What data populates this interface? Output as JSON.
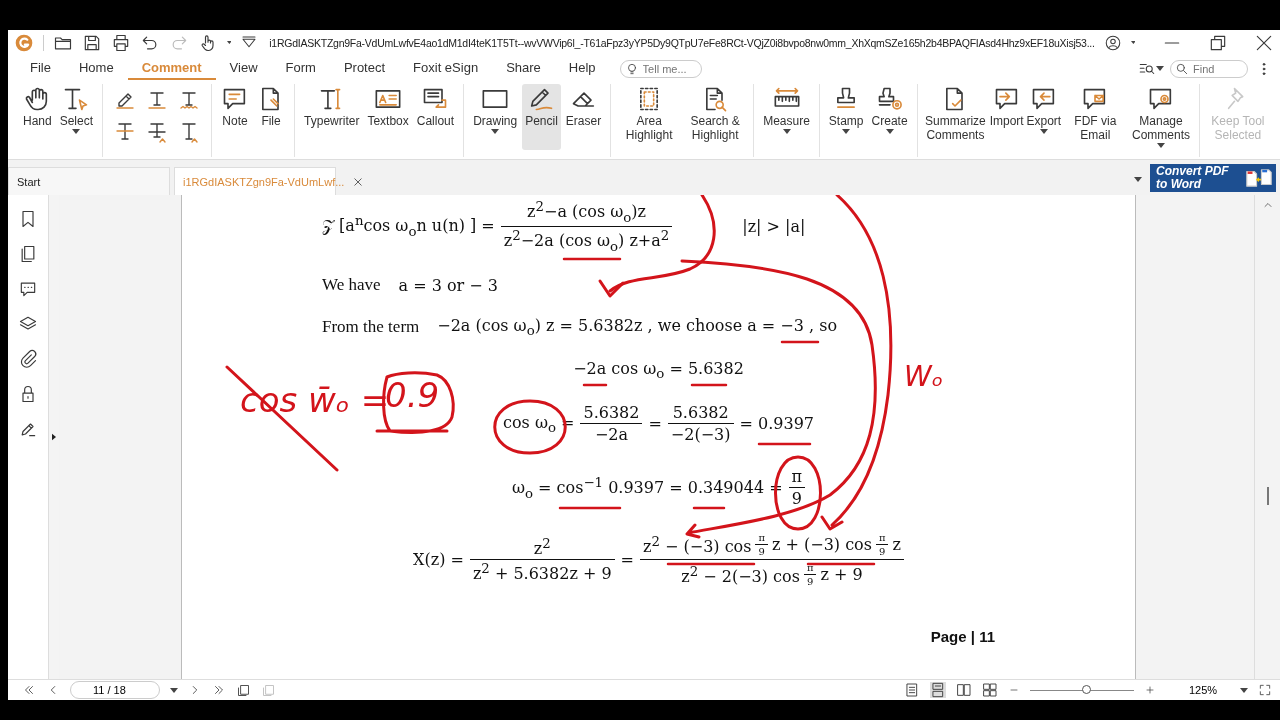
{
  "title_bar": {
    "file_name": "i1RGdIASKTZgn9Fa-VdUmLwfvE4ao1dM1dI4teK1T5Tt--wvVWVip6l_-T61aFpz3yYP5Dy9QTpU7eFe8RCt-VQjZ0i8bvpo8nw0mm_XhXqmSZe165h2b4BPAQFIAsd4Hhz9xEF18uXisj53..."
  },
  "menu": {
    "tabs": [
      {
        "label": "File",
        "selected": false
      },
      {
        "label": "Home",
        "selected": false
      },
      {
        "label": "Comment",
        "selected": true
      },
      {
        "label": "View",
        "selected": false
      },
      {
        "label": "Form",
        "selected": false
      },
      {
        "label": "Protect",
        "selected": false
      },
      {
        "label": "Foxit eSign",
        "selected": false
      },
      {
        "label": "Share",
        "selected": false
      },
      {
        "label": "Help",
        "selected": false
      }
    ],
    "tell_me": {
      "placeholder": "Tell me..."
    },
    "find": {
      "placeholder": "Find"
    }
  },
  "ribbon": {
    "groups": [
      {
        "kind": "tools",
        "tools": [
          {
            "label": "Hand",
            "caret": false,
            "selected": false,
            "disabled": false
          },
          {
            "label": "Select",
            "caret": true,
            "selected": false,
            "disabled": false
          }
        ]
      },
      {
        "kind": "markup"
      },
      {
        "kind": "tools",
        "tools": [
          {
            "label": "Note",
            "caret": false,
            "selected": false,
            "disabled": false
          },
          {
            "label": "File",
            "caret": false,
            "selected": false,
            "disabled": false
          }
        ]
      },
      {
        "kind": "tools",
        "tools": [
          {
            "label": "Typewriter",
            "caret": false,
            "selected": false,
            "disabled": false
          },
          {
            "label": "Textbox",
            "caret": false,
            "selected": false,
            "disabled": false
          },
          {
            "label": "Callout",
            "caret": false,
            "selected": false,
            "disabled": false
          }
        ]
      },
      {
        "kind": "tools",
        "tools": [
          {
            "label": "Drawing",
            "caret": true,
            "selected": false,
            "disabled": false
          },
          {
            "label": "Pencil",
            "caret": false,
            "selected": true,
            "disabled": false
          },
          {
            "label": "Eraser",
            "caret": false,
            "selected": false,
            "disabled": false
          }
        ]
      },
      {
        "kind": "tools",
        "tools": [
          {
            "label": "Area Highlight",
            "caret": false,
            "selected": false,
            "disabled": false
          },
          {
            "label": "Search & Highlight",
            "caret": false,
            "selected": false,
            "disabled": false
          }
        ]
      },
      {
        "kind": "tools",
        "tools": [
          {
            "label": "Measure",
            "caret": true,
            "selected": false,
            "disabled": false
          }
        ]
      },
      {
        "kind": "tools",
        "tools": [
          {
            "label": "Stamp",
            "caret": true,
            "selected": false,
            "disabled": false
          },
          {
            "label": "Create",
            "caret": true,
            "selected": false,
            "disabled": false
          }
        ]
      },
      {
        "kind": "tools",
        "tools": [
          {
            "label": "Summarize Comments",
            "caret": false,
            "selected": false,
            "disabled": false
          },
          {
            "label": "Import",
            "caret": false,
            "selected": false,
            "disabled": false
          },
          {
            "label": "Export",
            "caret": true,
            "selected": false,
            "disabled": false
          },
          {
            "label": "FDF via Email",
            "caret": false,
            "selected": false,
            "disabled": false
          },
          {
            "label": "Manage Comments",
            "caret": true,
            "selected": false,
            "disabled": false
          }
        ]
      },
      {
        "kind": "tools",
        "tools": [
          {
            "label": "Keep Tool Selected",
            "caret": false,
            "selected": false,
            "disabled": true
          }
        ]
      }
    ]
  },
  "doc_tabs": [
    {
      "label": "Start",
      "selected": false,
      "closable": false
    },
    {
      "label": "i1RGdIASKTZgn9Fa-VdUmLwf...",
      "selected": true,
      "closable": true
    }
  ],
  "banner": {
    "text": "Convert PDF to Word"
  },
  "page": {
    "lines": [
      {
        "kind": "statement",
        "parts": [
          {
            "kind": "text",
            "text": "𝒵 [a$^{n}$cos ω$_{o}$n u(n) ] ="
          },
          {
            "kind": "fraction",
            "num": "z$^{2}$−a (cos ω$_{o}$)z",
            "den": "z$^{2}$−2a (cos ω$_{o}$) z+a$^{2}$"
          },
          {
            "kind": "aside",
            "text": "|z| > |a|"
          }
        ]
      },
      {
        "kind": "statement",
        "parts": [
          {
            "kind": "prose",
            "text": "We have"
          },
          {
            "kind": "text",
            "text": "a = 3 or − 3"
          }
        ]
      },
      {
        "kind": "statement",
        "parts": [
          {
            "kind": "prose",
            "text": "From the term"
          },
          {
            "kind": "text",
            "text": "−2a (cos ω$_{o}$) z = 5.6382z , we choose a = −3 , so"
          }
        ]
      },
      {
        "kind": "display",
        "parts": [
          {
            "kind": "text",
            "text": "−2a cos ω$_{o}$ = 5.6382"
          }
        ]
      },
      {
        "kind": "display",
        "parts": [
          {
            "kind": "text",
            "text": "cos ω$_{o}$ ="
          },
          {
            "kind": "fraction",
            "num": "5.6382",
            "den": "−2a"
          },
          {
            "kind": "text",
            "text": "="
          },
          {
            "kind": "fraction",
            "num": "5.6382",
            "den": "−2(−3)"
          },
          {
            "kind": "text",
            "text": "= 0.9397"
          }
        ]
      },
      {
        "kind": "display",
        "parts": [
          {
            "kind": "text",
            "text": "ω$_{o}$ = cos$^{−1}$ 0.9397 = 0.349044 ="
          },
          {
            "kind": "fraction",
            "num": "π",
            "den": "9"
          }
        ]
      },
      {
        "kind": "display",
        "parts": [
          {
            "kind": "text",
            "text": "X(z) ="
          },
          {
            "kind": "fraction",
            "num": "z$^{2}$",
            "den": "z$^{2}$ + 5.6382z + 9"
          },
          {
            "kind": "text",
            "text": "="
          },
          {
            "kind": "fraction",
            "num": [
              {
                "kind": "text",
                "text": "z$^{2}$ − (−3) cos"
              },
              {
                "kind": "fraction",
                "num": "π",
                "den": "9"
              },
              {
                "kind": "text",
                "text": "z + (−3) cos"
              },
              {
                "kind": "fraction",
                "num": "π",
                "den": "9"
              },
              {
                "kind": "text",
                "text": "z"
              }
            ],
            "den": [
              {
                "kind": "text",
                "text": "z$^{2}$ − 2(−3) cos"
              },
              {
                "kind": "fraction",
                "num": "π",
                "den": "9"
              },
              {
                "kind": "text",
                "text": "z + 9"
              }
            ]
          }
        ]
      }
    ],
    "page_label": "Page | 11"
  },
  "ink_notes": [
    {
      "text": "cos w̄ₒ ="
    },
    {
      "text": "0.9"
    },
    {
      "text": "Wₒ"
    }
  ],
  "status_bar": {
    "page_field": {
      "value": "11 / 18"
    },
    "zoom_slider": {
      "level": 0.55
    },
    "zoom_field": {
      "value": "125%"
    }
  }
}
